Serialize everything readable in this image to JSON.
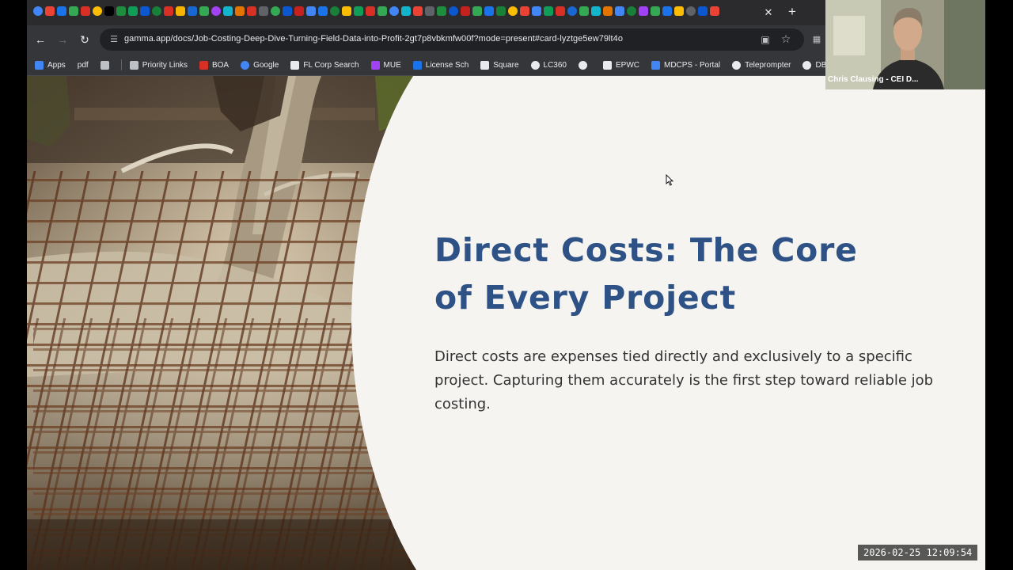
{
  "browser": {
    "tab_favicon_colors": [
      "#4285f4",
      "#ea4335",
      "#1a73e8",
      "#34a853",
      "#d93025",
      "#fbbc04",
      "#000000",
      "#1e8e3e",
      "#0f9d58",
      "#0b57d0",
      "#188038",
      "#d93025",
      "#f4b400",
      "#1967d2",
      "#34a853",
      "#a142f4",
      "#12b5cb",
      "#e37400",
      "#d93025",
      "#5f6368",
      "#34a853",
      "#0b57d0",
      "#c5221f",
      "#4285f4",
      "#1a73e8",
      "#188038",
      "#fbbc04",
      "#0f9d58",
      "#d93025",
      "#34a853",
      "#4285f4",
      "#12b5cb",
      "#ea4335",
      "#5f6368",
      "#1e8e3e",
      "#0b57d0",
      "#c5221f",
      "#34a853",
      "#1a73e8",
      "#188038",
      "#fbbc04",
      "#ea4335",
      "#4285f4",
      "#0f9d58",
      "#d93025",
      "#1967d2",
      "#34a853",
      "#12b5cb",
      "#e37400",
      "#4285f4",
      "#188038",
      "#a142f4",
      "#34a853",
      "#1a73e8",
      "#fbbc04",
      "#5f6368",
      "#0b57d0",
      "#ea4335",
      "#1e8e3e",
      "#4285f4",
      "#d93025",
      "#34a853",
      "#12b5cb",
      "#1a73e8",
      "#188038",
      "#fbbc04",
      "#4285f4",
      "#0f9d58",
      "#5f6368",
      "#ea4335",
      "#34a853",
      "#1967d2",
      "#c5221f",
      "#4285f4",
      "#12b5cb",
      "#1a73e8",
      "#34a853",
      "#188038",
      "#fbbc04",
      "#4285f4"
    ],
    "tab_close": "✕",
    "new_tab": "+",
    "back": "←",
    "forward": "→",
    "reload": "↻",
    "url": "gamma.app/docs/Job-Costing-Deep-Dive-Turning-Field-Data-into-Profit-2gt7p8vbkmfw00f?mode=present#card-lyztge5ew79lt4o"
  },
  "bookmarks": [
    {
      "label": "Apps",
      "icon_color": "#4285f4",
      "name": "bookmark-apps"
    },
    {
      "label": "pdf",
      "icon_color": "",
      "name": "bookmark-pdf"
    },
    {
      "label": "",
      "icon_color": "#bdc1c6",
      "name": "bookmark-grid"
    },
    {
      "label": "Priority Links",
      "icon_color": "#bdc1c6",
      "name": "bookmark-priority-links"
    },
    {
      "label": "BOA",
      "icon_color": "#d93025",
      "name": "bookmark-boa"
    },
    {
      "label": "Google",
      "icon_color": "#4285f4",
      "name": "bookmark-google"
    },
    {
      "label": "FL Corp Search",
      "icon_color": "#e8eaed",
      "name": "bookmark-fl-corp-search"
    },
    {
      "label": "MUE",
      "icon_color": "#a142f4",
      "name": "bookmark-mue"
    },
    {
      "label": "License Sch",
      "icon_color": "#1a73e8",
      "name": "bookmark-license-sch"
    },
    {
      "label": "Square",
      "icon_color": "#e8eaed",
      "name": "bookmark-square"
    },
    {
      "label": "LC360",
      "icon_color": "#e8eaed",
      "name": "bookmark-lc360"
    },
    {
      "label": "",
      "icon_color": "#e8eaed",
      "name": "bookmark-globe"
    },
    {
      "label": "EPWC",
      "icon_color": "#e8eaed",
      "name": "bookmark-epwc"
    },
    {
      "label": "MDCPS - Portal",
      "icon_color": "#4285f4",
      "name": "bookmark-mdcps-portal"
    },
    {
      "label": "Teleprompter",
      "icon_color": "#e8eaed",
      "name": "bookmark-teleprompter"
    },
    {
      "label": "DBPR Forms",
      "icon_color": "#e8eaed",
      "name": "bookmark-dbpr-forms"
    }
  ],
  "slide": {
    "title": "Direct Costs: The Core of Every Project",
    "body": "Direct costs are expenses tied directly and exclusively to a specific project. Capturing them accurately is the first step toward reliable job costing.",
    "title_color": "#2e5286",
    "background": "#f5f4f1"
  },
  "webcam": {
    "label": "Chris Clausing - CEI D..."
  },
  "timestamp": "2026-02-25  12:09:54"
}
